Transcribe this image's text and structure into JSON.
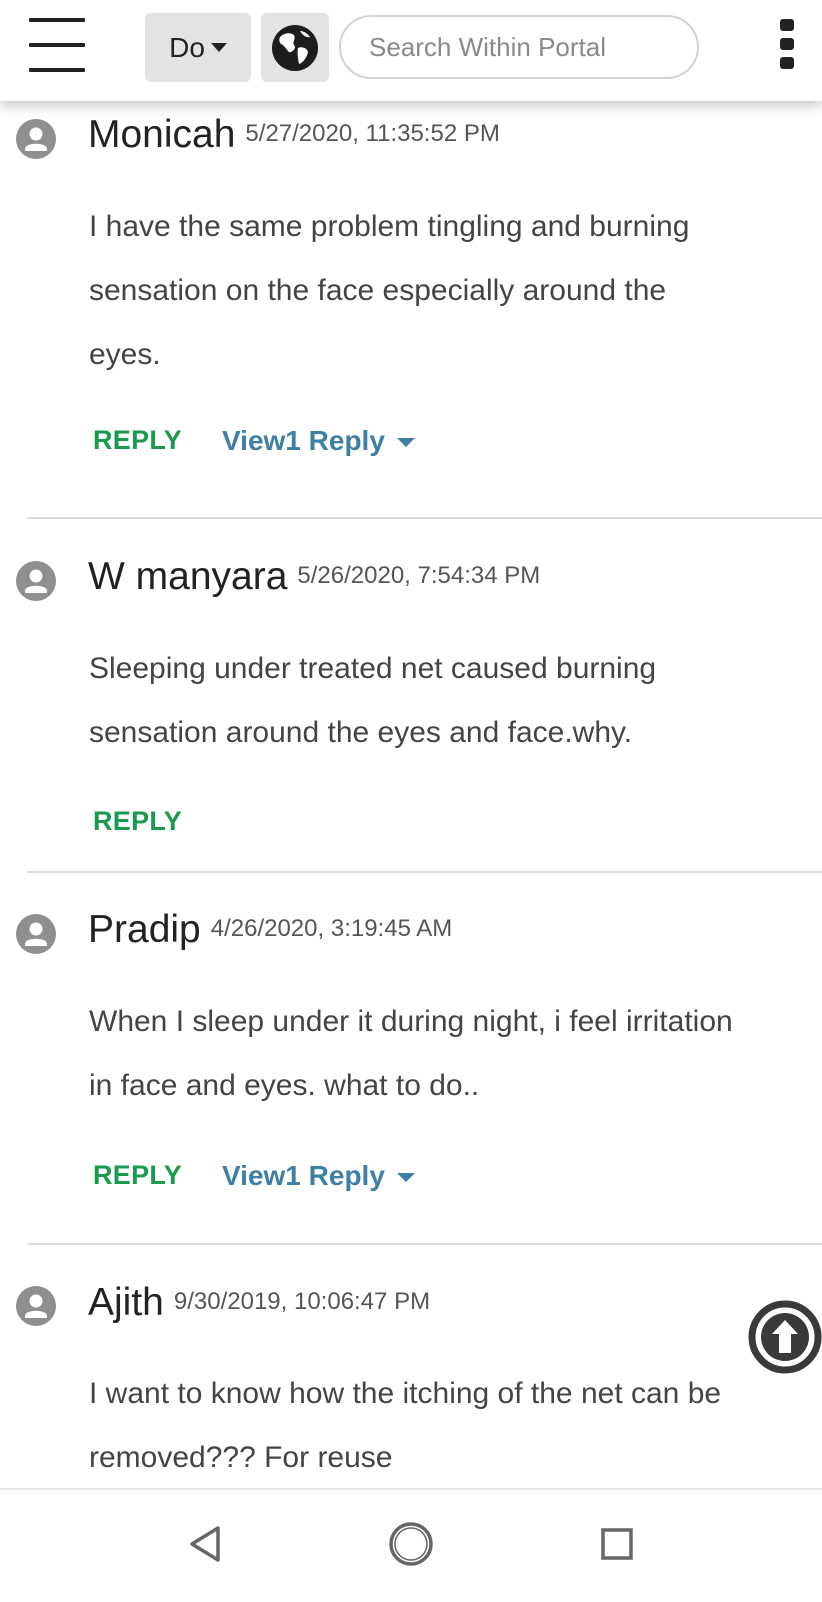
{
  "header": {
    "language_label": "Do",
    "search_placeholder": "Search Within Portal"
  },
  "comments": [
    {
      "author": "Monicah",
      "date": "5/27/2020, 11:35:52 PM",
      "lines": [
        "I have the same problem tingling and burning",
        "sensation on the face especially around the",
        "eyes."
      ],
      "reply_label": "REPLY",
      "view_replies_label": "View1 Reply"
    },
    {
      "author": "W manyara",
      "date": "5/26/2020, 7:54:34 PM",
      "lines": [
        "Sleeping under treated net caused burning",
        "sensation around the eyes and face.why."
      ],
      "reply_label": "REPLY"
    },
    {
      "author": "Pradip",
      "date": "4/26/2020, 3:19:45 AM",
      "lines": [
        "When I sleep under it during night, i feel irritation",
        "in face and eyes. what to do.."
      ],
      "reply_label": "REPLY",
      "view_replies_label": "View1 Reply"
    },
    {
      "author": "Ajith",
      "date": "9/30/2019, 10:06:47 PM",
      "lines": [
        "I want to know how the itching of the net can be",
        "removed??? For reuse"
      ]
    }
  ],
  "icons": {
    "menu": "hamburger-menu-icon",
    "globe": "globe-icon",
    "more": "kebab-menu-icon",
    "avatar": "user-avatar-icon",
    "scroll_top": "arrow-up-circle-icon",
    "nav_back": "back-triangle-icon",
    "nav_home": "home-circle-icon",
    "nav_recent": "recent-apps-square-icon"
  },
  "colors": {
    "reply": "#1a9a4f",
    "view_replies": "#3d7fa5",
    "header_button_bg": "#e3e3e3"
  }
}
